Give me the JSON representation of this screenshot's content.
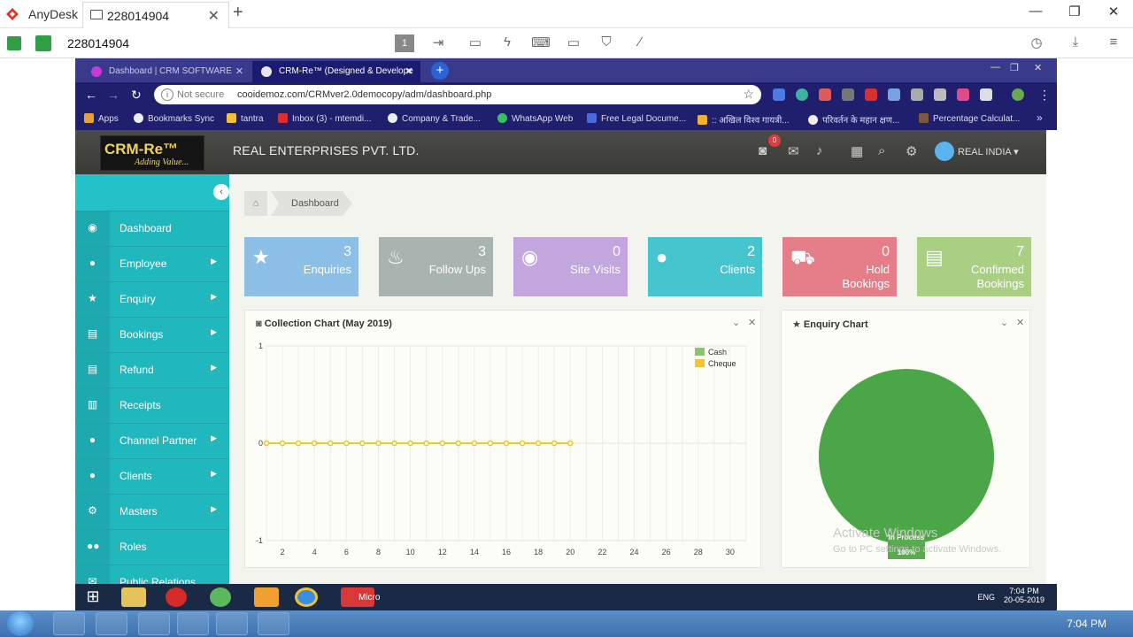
{
  "anydesk": {
    "app_name": "AnyDesk",
    "tab_label": "228014904",
    "tab_close": "✕",
    "new_tab": "+",
    "address": "228014904",
    "win_min": "—",
    "win_max": "❐",
    "win_close": "✕",
    "monitor_badge": "1"
  },
  "chrome": {
    "tabs": [
      {
        "label": "Dashboard | CRM SOFTWARE",
        "close": "✕"
      },
      {
        "label": "CRM-Re™ (Designed & Develope",
        "close": "✕"
      }
    ],
    "new_tab": "+",
    "not_secure": "Not secure",
    "url": "cooidemoz.com/CRMver2.0democopy/adm/dashboard.php",
    "bookmarks": [
      "Apps",
      "Bookmarks Sync",
      "tantra",
      "Inbox (3) - mtemdi...",
      "Company & Trade...",
      "WhatsApp Web",
      "Free Legal Docume...",
      ":: अखिल विश्व गायत्री...",
      "परिवर्तन के महान क्षण...",
      "Percentage Calculat..."
    ],
    "bookmarks_more": "»",
    "win_min": "—",
    "win_max": "❐",
    "win_close": "✕"
  },
  "app": {
    "logo_main": "CRM-Re™",
    "logo_sub": "Adding Value...",
    "company_name": "REAL ENTERPRISES PVT. LTD.",
    "notification_count": "0",
    "user_name": "REAL INDIA ▾",
    "sidebar_toggle": "‹",
    "sidebar": [
      {
        "label": "Dashboard",
        "icon": "dashboard-icon",
        "arrow": ""
      },
      {
        "label": "Employee",
        "icon": "user-icon",
        "arrow": "▶"
      },
      {
        "label": "Enquiry",
        "icon": "star-icon",
        "arrow": "▶"
      },
      {
        "label": "Bookings",
        "icon": "book-icon",
        "arrow": "▶"
      },
      {
        "label": "Refund",
        "icon": "book-icon",
        "arrow": "▶"
      },
      {
        "label": "Receipts",
        "icon": "document-icon",
        "arrow": ""
      },
      {
        "label": "Channel Partner",
        "icon": "user-icon",
        "arrow": "▶"
      },
      {
        "label": "Clients",
        "icon": "user-icon",
        "arrow": "▶"
      },
      {
        "label": "Masters",
        "icon": "gears-icon",
        "arrow": "▶"
      },
      {
        "label": "Roles",
        "icon": "users-icon",
        "arrow": ""
      },
      {
        "label": "Public Relations",
        "icon": "mail-icon",
        "arrow": ""
      }
    ],
    "breadcrumb": "Dashboard",
    "stats": [
      {
        "count": "3",
        "label": "Enquiries",
        "color": "#8cbfe6",
        "icon": "star-icon"
      },
      {
        "count": "3",
        "label": "Follow Ups",
        "color": "#a9b3b0",
        "icon": "fire-icon"
      },
      {
        "count": "0",
        "label": "Site Visits",
        "color": "#c3a6dd",
        "icon": "eye-icon"
      },
      {
        "count": "2",
        "label": "Clients",
        "color": "#45c6cf",
        "icon": "user-icon"
      },
      {
        "count": "0",
        "label": "Hold Bookings",
        "color": "#e57e89",
        "icon": "cart-icon"
      },
      {
        "count": "7",
        "label": "Confirmed Bookings",
        "color": "#a9cf82",
        "icon": "book-icon"
      }
    ],
    "collection_title": "Collection Chart (May 2019)",
    "enquiry_title": "Enquiry Chart",
    "panel_collapse": "⌄",
    "panel_close": "✕"
  },
  "chart_data": [
    {
      "type": "line",
      "title": "Collection Chart (May 2019)",
      "xlabel": "",
      "ylabel": "",
      "xlim": [
        1,
        31
      ],
      "ylim": [
        -1,
        1
      ],
      "x_ticks": [
        2,
        4,
        6,
        8,
        10,
        12,
        14,
        16,
        18,
        20,
        22,
        24,
        26,
        28,
        30
      ],
      "y_ticks": [
        1,
        0,
        -1
      ],
      "legend": "top-right",
      "x": [
        1,
        2,
        3,
        4,
        5,
        6,
        7,
        8,
        9,
        10,
        11,
        12,
        13,
        14,
        15,
        16,
        17,
        18,
        19,
        20
      ],
      "series": [
        {
          "name": "Cash",
          "color": "#8bc66a",
          "values": [
            0,
            0,
            0,
            0,
            0,
            0,
            0,
            0,
            0,
            0,
            0,
            0,
            0,
            0,
            0,
            0,
            0,
            0,
            0,
            0
          ]
        },
        {
          "name": "Cheque",
          "color": "#f2c62f",
          "values": [
            0,
            0,
            0,
            0,
            0,
            0,
            0,
            0,
            0,
            0,
            0,
            0,
            0,
            0,
            0,
            0,
            0,
            0,
            0,
            0
          ]
        }
      ]
    },
    {
      "type": "pie",
      "title": "Enquiry Chart",
      "categories": [
        "In Process"
      ],
      "values": [
        100
      ],
      "labels": [
        "100%"
      ],
      "colors": [
        "#4aa646"
      ]
    }
  ],
  "watermark": {
    "line1": "Activate Windows",
    "line2": "Go to PC settings to activate Windows."
  },
  "remote_taskbar": {
    "micro_label": "Micro",
    "lang": "ENG",
    "time": "7:04 PM",
    "date": "20-05-2019"
  },
  "taskbar": {
    "time": "7:04 PM"
  }
}
